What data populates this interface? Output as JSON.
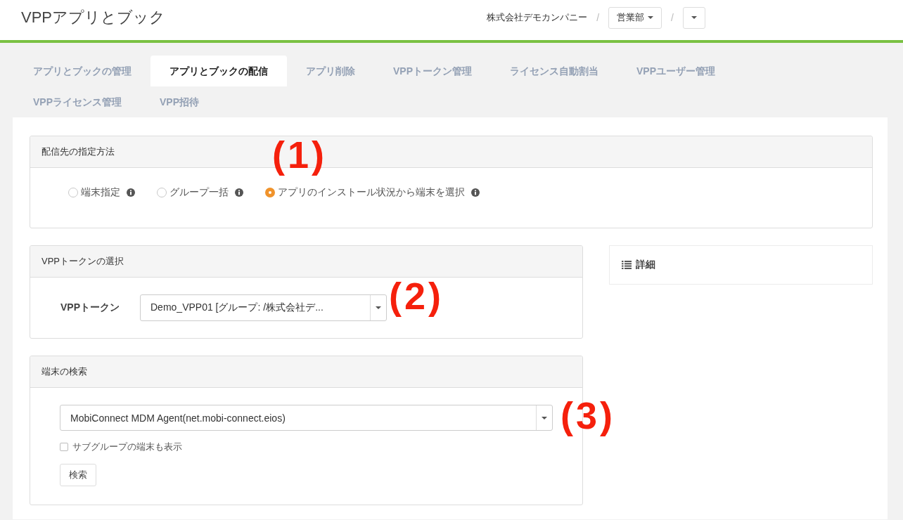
{
  "header": {
    "title": "VPPアプリとブック",
    "breadcrumb": [
      {
        "kind": "text",
        "label": "株式会社デモカンパニー"
      },
      {
        "kind": "separator",
        "label": "/"
      },
      {
        "kind": "dropdown",
        "label": "営業部"
      },
      {
        "kind": "separator",
        "label": "/"
      },
      {
        "kind": "dropdown"
      }
    ]
  },
  "tabs": [
    {
      "label": "アプリとブックの管理",
      "selected": false
    },
    {
      "label": "アプリとブックの配信",
      "selected": true
    },
    {
      "label": "アプリ削除",
      "selected": false
    },
    {
      "label": "VPPトークン管理",
      "selected": false
    },
    {
      "label": "ライセンス自動割当",
      "selected": false
    },
    {
      "label": "VPPユーザー管理",
      "selected": false
    },
    {
      "label": "VPPライセンス管理",
      "selected": false
    },
    {
      "label": "VPP招待",
      "selected": false
    }
  ],
  "delivery_method": {
    "title": "配信先の指定方法",
    "annotation": "(1)",
    "options": [
      {
        "label": "端末指定",
        "selected": false
      },
      {
        "label": "グループ一括",
        "selected": false
      },
      {
        "label": "アプリのインストール状況から端末を選択",
        "selected": true
      }
    ]
  },
  "vpp_token": {
    "title": "VPPトークンの選択",
    "label": "VPPトークン",
    "value": "Demo_VPP01 [グループ: /株式会社デ...",
    "annotation": "(2)"
  },
  "details": {
    "title": "詳細"
  },
  "device_search": {
    "title": "端末の検索",
    "app_value": "MobiConnect MDM Agent(net.mobi-connect.eios)",
    "annotation": "(3)",
    "subgroup_checkbox": {
      "label": "サブグループの端末も表示",
      "checked": false
    },
    "button": "検索"
  }
}
